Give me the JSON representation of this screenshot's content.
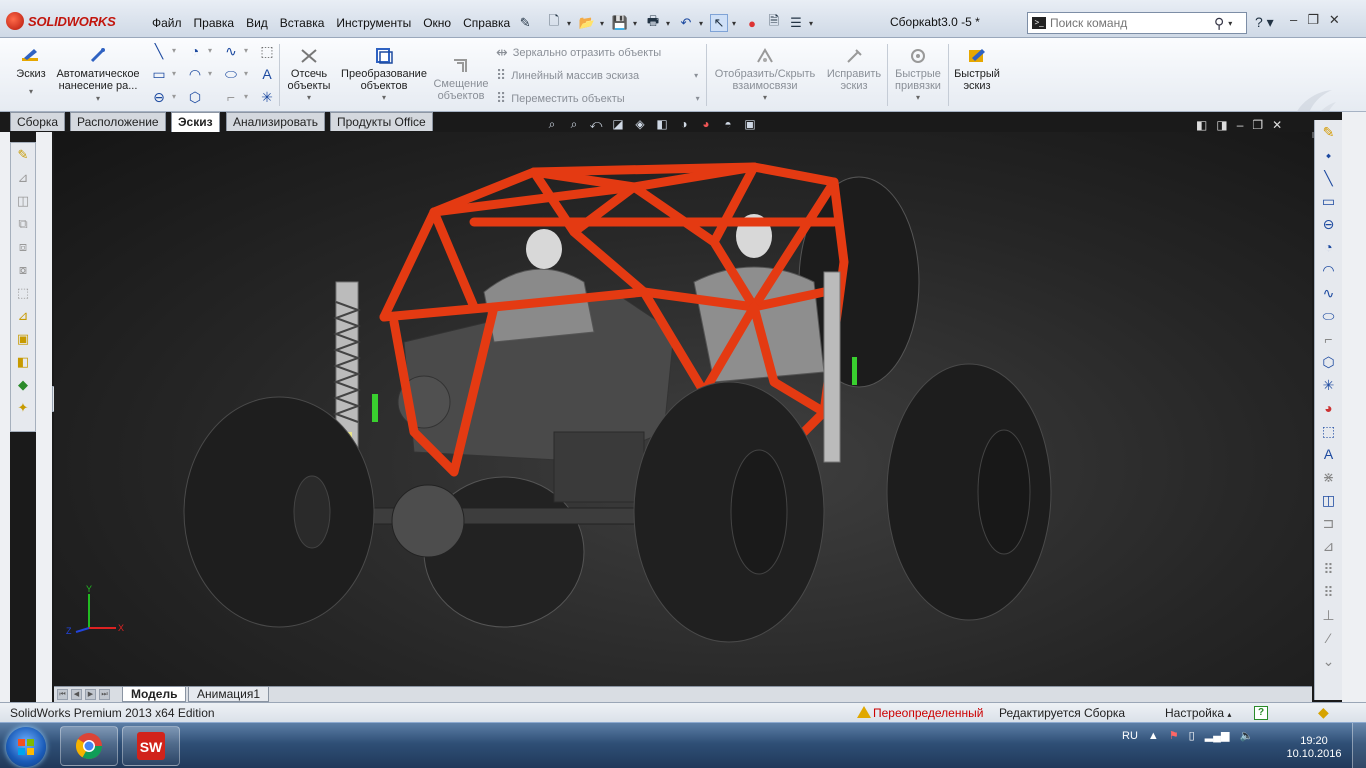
{
  "app": {
    "brand": "SOLIDWORKS",
    "document_title": "Сборкаbt3.0 -5 *"
  },
  "menu": [
    "Файл",
    "Правка",
    "Вид",
    "Вставка",
    "Инструменты",
    "Окно",
    "Справка"
  ],
  "search": {
    "placeholder": "Поиск команд"
  },
  "help": {
    "label": "?"
  },
  "ribbon": {
    "sketch": "Эскиз",
    "auto_dim": "Автоматическое нанесение ра...",
    "trim": "Отсечь объекты",
    "convert": "Преобразование объектов",
    "offset": "Смещение объектов",
    "mirror": "Зеркально отразить объекты",
    "linear_pattern": "Линейный массив эскиза",
    "move": "Переместить объекты",
    "show_relations": "Отобразить/Скрыть взаимосвязи",
    "repair": "Исправить эскиз",
    "quick_snaps": "Быстрые привязки",
    "rapid_sketch": "Быстрый эскиз"
  },
  "tabs": [
    "Сборка",
    "Расположение",
    "Эскиз",
    "Анализировать",
    "Продукты Office"
  ],
  "active_tab": "Эскиз",
  "bottom_tabs": [
    "Модель",
    "Анимация1"
  ],
  "status": {
    "edition": "SolidWorks Premium 2013 x64 Edition",
    "overdefined": "Переопределенный",
    "editing": "Редактируется Сборка",
    "settings": "Настройка",
    "help_q": "?"
  },
  "taskbar": {
    "lang": "RU",
    "time": "19:20",
    "date": "10.10.2016"
  },
  "triad": {
    "x": "X",
    "y": "Y",
    "z": "Z"
  },
  "colors": {
    "frame": "#e43a12",
    "tire": "#1e1e1e",
    "accent": "#1d4aa0",
    "brand": "#c2150d"
  }
}
